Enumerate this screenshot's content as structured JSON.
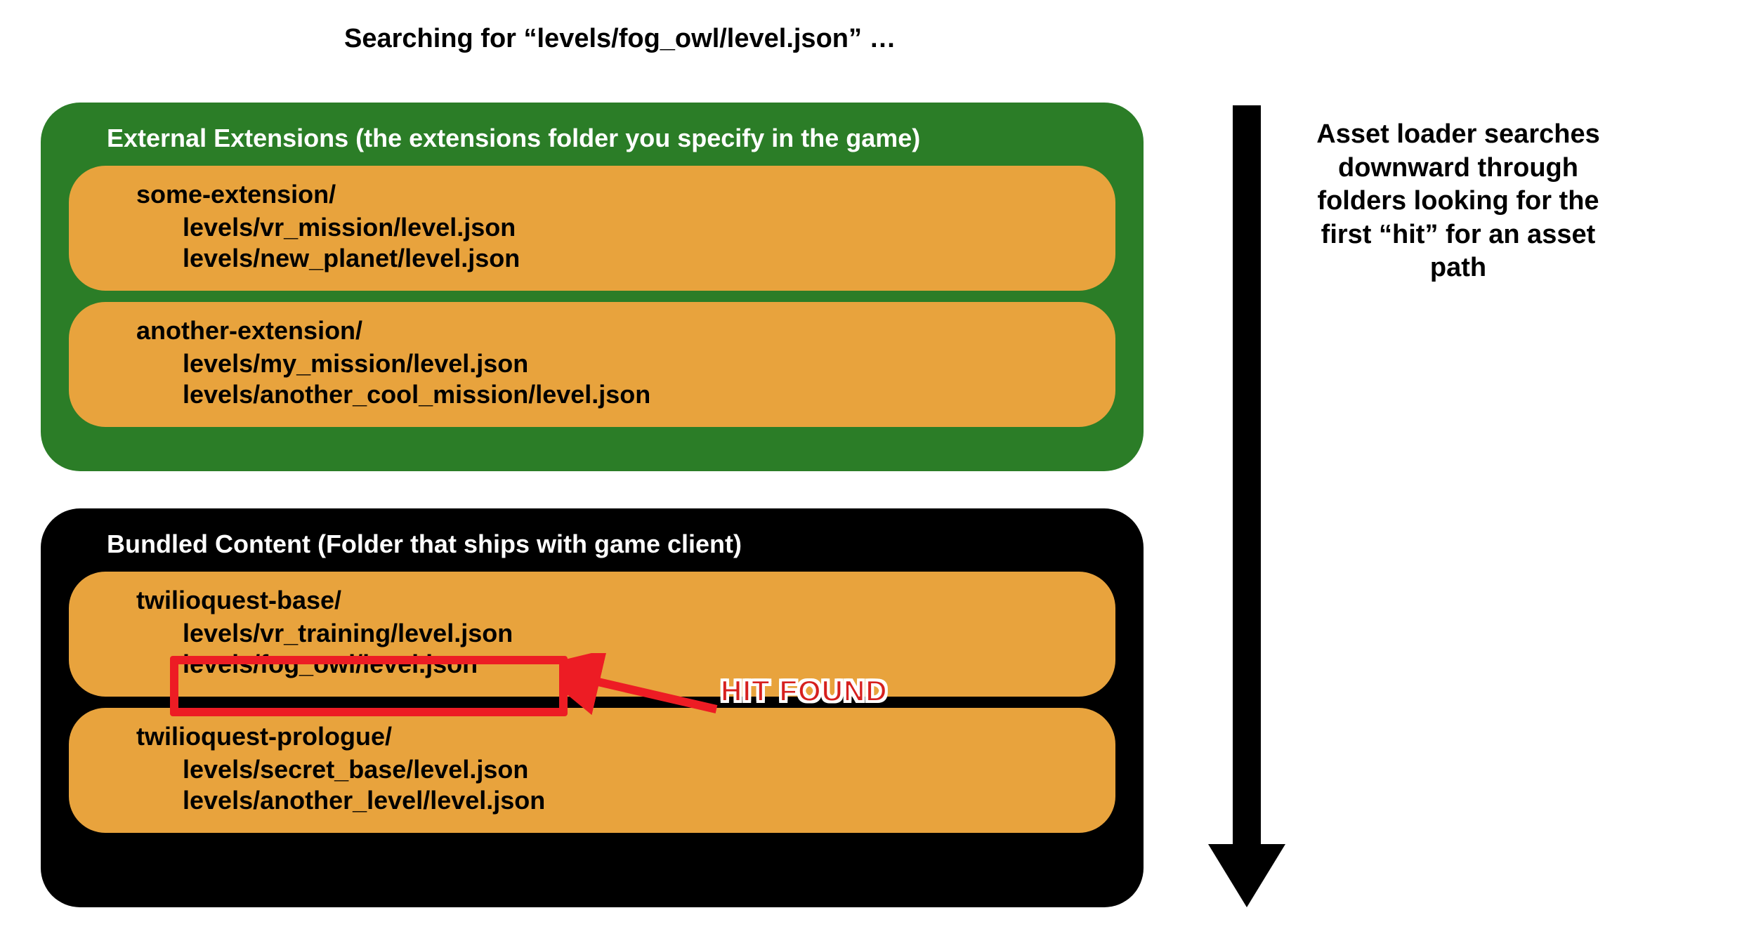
{
  "heading": "Searching for “levels/fog_owl/level.json” …",
  "side_text": "Asset loader searches downward through folders looking for the first “hit” for an asset path",
  "panels": {
    "external": {
      "title": "External Extensions (the extensions folder you specify in the game)",
      "items": [
        {
          "name": "some-extension/",
          "paths": [
            "levels/vr_mission/level.json",
            "levels/new_planet/level.json"
          ]
        },
        {
          "name": "another-extension/",
          "paths": [
            "levels/my_mission/level.json",
            "levels/another_cool_mission/level.json"
          ]
        }
      ]
    },
    "bundled": {
      "title": "Bundled Content (Folder that ships with game client)",
      "items": [
        {
          "name": "twilioquest-base/",
          "paths": [
            "levels/vr_training/level.json",
            "levels/fog_owl/level.json"
          ]
        },
        {
          "name": "twilioquest-prologue/",
          "paths": [
            "levels/secret_base/level.json",
            "levels/another_level/level.json"
          ]
        }
      ]
    }
  },
  "hit_label": "HIT FOUND",
  "colors": {
    "green": "#2b7d27",
    "black": "#000000",
    "orange": "#e8a33d",
    "red": "#ed1c24"
  }
}
